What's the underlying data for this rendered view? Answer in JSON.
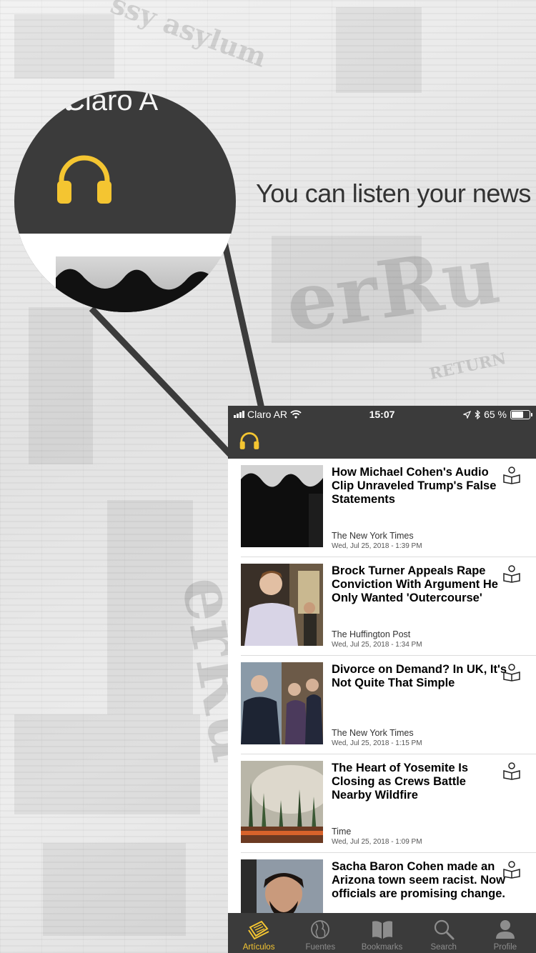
{
  "promo": {
    "tagline": "You can listen your news",
    "magnifier_carrier": "Claro A"
  },
  "status_bar": {
    "carrier": "Claro AR",
    "time": "15:07",
    "battery": "65 %",
    "battery_level": 0.65
  },
  "nav": {
    "listen_icon": "headphones-icon",
    "accent_color": "#f4c531"
  },
  "articles": [
    {
      "title": "How Michael Cohen's Audio Clip Unraveled Trump's False Statements",
      "source": "The New York Times",
      "date": "Wed, Jul 25, 2018 - 1:39 PM",
      "icon": "reader-icon"
    },
    {
      "title": "Brock Turner Appeals Rape Conviction With Argument He Only Wanted 'Outercourse'",
      "source": "The Huffington Post",
      "date": "Wed, Jul 25, 2018 - 1:34 PM",
      "icon": "reader-icon"
    },
    {
      "title": "Divorce on Demand? In UK, It's Not Quite That Simple",
      "source": "The New York Times",
      "date": "Wed, Jul 25, 2018 - 1:15 PM",
      "icon": "reader-icon"
    },
    {
      "title": "The Heart of Yosemite Is Closing as Crews Battle Nearby Wildfire",
      "source": "Time",
      "date": "Wed, Jul 25, 2018 - 1:09 PM",
      "icon": "reader-icon"
    },
    {
      "title": "Sacha Baron Cohen made an Arizona town seem racist. Now officials are promising change.",
      "source": "",
      "date": "",
      "icon": "reader-icon"
    }
  ],
  "tabs": [
    {
      "label": "Artículos",
      "icon": "newspaper-icon",
      "active": true
    },
    {
      "label": "Fuentes",
      "icon": "globe-icon",
      "active": false
    },
    {
      "label": "Bookmarks",
      "icon": "book-icon",
      "active": false
    },
    {
      "label": "Search",
      "icon": "search-icon",
      "active": false
    },
    {
      "label": "Profile",
      "icon": "person-icon",
      "active": false
    }
  ]
}
